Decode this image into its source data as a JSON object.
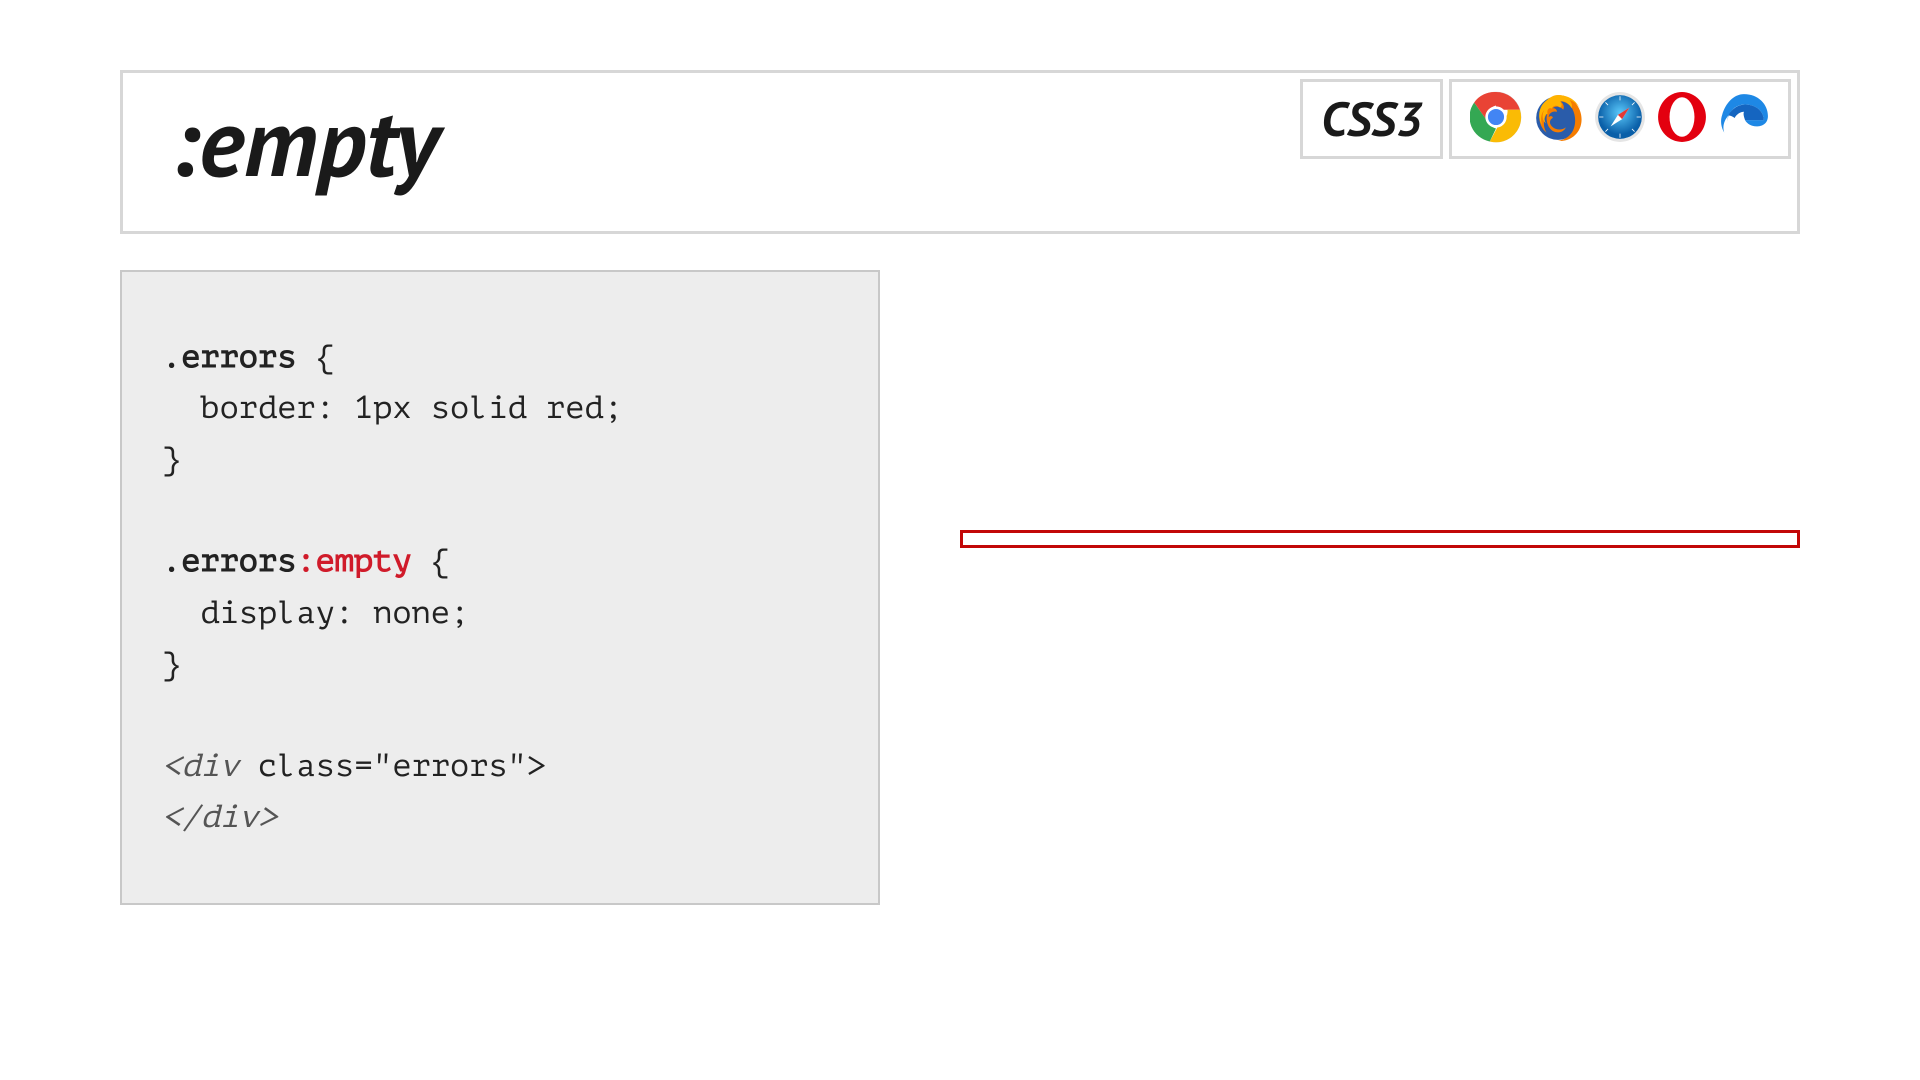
{
  "header": {
    "title": ":empty",
    "spec": "CSS3"
  },
  "browsers": [
    "chrome",
    "firefox",
    "safari",
    "opera",
    "edge"
  ],
  "code": {
    "sel1": ".errors",
    "rule1_prop": "  border: 1px solid red;",
    "sel2a": ".errors",
    "sel2b": ":empty",
    "rule2_prop": "  display: none;",
    "html_open": "<div",
    "html_attr": " class=\"errors\">",
    "html_close": "</div>"
  }
}
